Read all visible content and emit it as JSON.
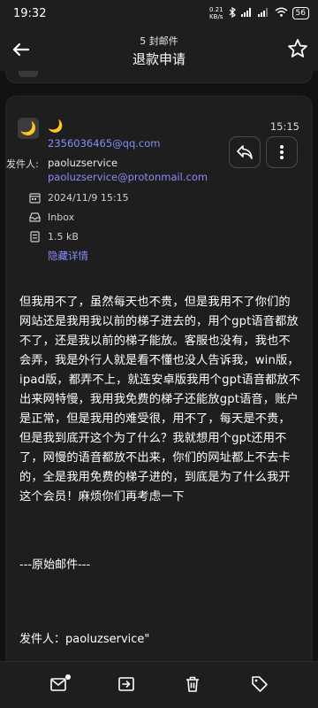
{
  "status_bar": {
    "time": "19:32",
    "net_speed_value": "0.21",
    "net_speed_unit": "KB/s",
    "battery": "56"
  },
  "header": {
    "subtitle": "5 封邮件",
    "title": "退款申请"
  },
  "message": {
    "sender_display": "🌙",
    "sender_email": "2356036465@qq.com",
    "time": "15:15",
    "to_label": "发件人:",
    "to_name": "paoluzservice",
    "to_email": "paoluzservice@protonmail.com",
    "date": "2024/11/9 15:15",
    "folder": "Inbox",
    "size": "1.5 kB",
    "hide_details": "隐藏详情",
    "body": "但我用不了，虽然每天也不贵，但是我用不了你们的网站还是我用我以前的梯子进去的，用个gpt语音都放不了，还是我以前的梯子能放。客服也没有，我也不会弄，我是外行人就是看不懂也没人告诉我，win版，ipad版，都弄不上，就连安卓版我用个gpt语音都放不出来网特慢，我用我免费的梯子还能放gpt语音，账户是正常，但是我用的难受很，用不了，每天是不贵，但是我到底开这个为了什么？我就想用个gpt还用不了，网慢的语音都放不出来，你们的网址都上不去卡的，全是我用免费的梯子进的，到底是为了什么我开这个会员！麻烦你们再考虑一下",
    "original_separator": "---原始邮件---",
    "original_from": "发件人：paoluzservice\""
  },
  "colors": {
    "accent": "#8a8cf5",
    "background": "#121212",
    "surface": "#1e1e1e"
  },
  "icons": {
    "back": "arrow-left-icon",
    "star": "star-icon",
    "reply": "reply-icon",
    "more": "more-vertical-icon",
    "date": "calendar-icon",
    "folder": "inbox-icon",
    "size": "storage-icon",
    "bottom": [
      "mark-unread-icon",
      "move-to-folder-icon",
      "delete-icon",
      "label-icon"
    ]
  }
}
